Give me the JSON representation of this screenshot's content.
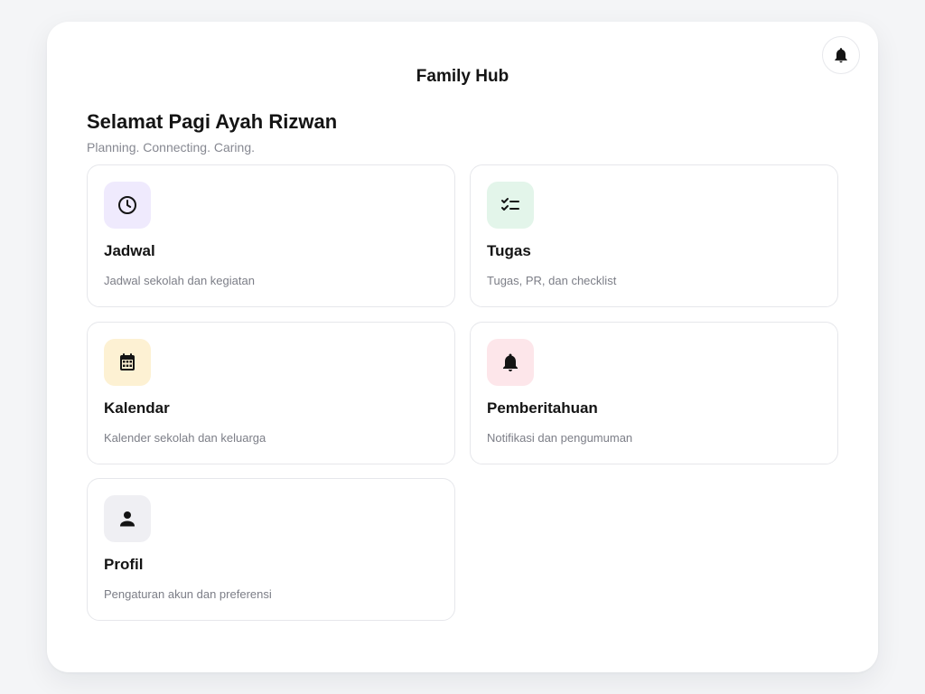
{
  "header": {
    "title": "Family Hub",
    "notification_icon": "bell-icon"
  },
  "greeting": {
    "title": "Selamat Pagi Ayah Rizwan",
    "subtitle": "Planning. Connecting. Caring."
  },
  "tiles": [
    {
      "title": "Jadwal",
      "description": "Jadwal sekolah dan kegiatan",
      "icon": "clock-icon",
      "icon_bg": "#efeafd"
    },
    {
      "title": "Tugas",
      "description": "Tugas, PR, dan checklist",
      "icon": "checklist-icon",
      "icon_bg": "#e3f5ea"
    },
    {
      "title": "Kalendar",
      "description": "Kalender sekolah dan keluarga",
      "icon": "calendar-icon",
      "icon_bg": "#fdf1d3"
    },
    {
      "title": "Pemberitahuan",
      "description": "Notifikasi dan pengumuman",
      "icon": "bell-icon",
      "icon_bg": "#fde6ea"
    },
    {
      "title": "Profil",
      "description": "Pengaturan akun dan preferensi",
      "icon": "person-icon",
      "icon_bg": "#efeff3"
    }
  ],
  "colors": {
    "background": "#f4f5f7",
    "card": "#ffffff",
    "text_primary": "#141414",
    "text_secondary": "#868891"
  }
}
